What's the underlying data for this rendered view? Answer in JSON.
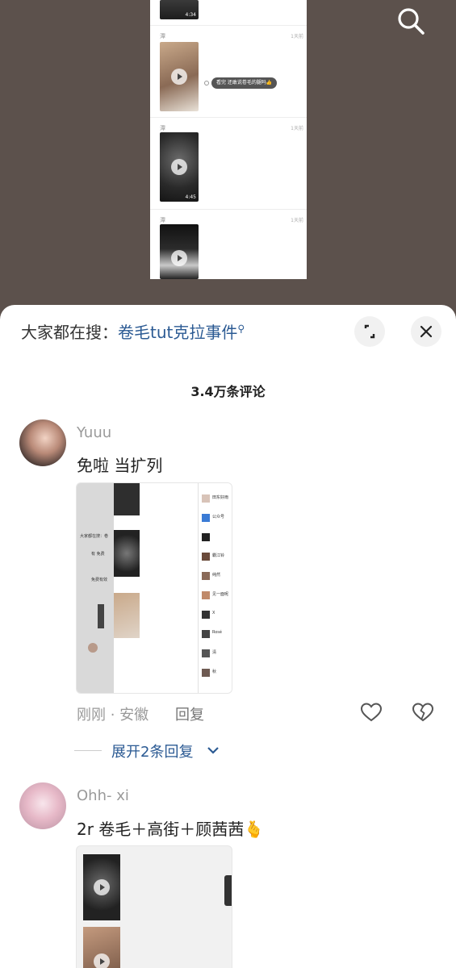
{
  "video": {
    "search_icon": "search-icon",
    "screenshot_rows": [
      {
        "name": "",
        "time": "",
        "duration": "4:34"
      },
      {
        "name": "潭",
        "time": "1天前",
        "duration": "",
        "bubble": "看完 还敢说卷毛的腿吗👍"
      },
      {
        "name": "潭",
        "time": "1天前",
        "duration": "4:45"
      },
      {
        "name": "潭",
        "time": "1天前",
        "duration": ""
      }
    ]
  },
  "sheet": {
    "hot_search_prefix": "大家都在搜：",
    "hot_search_keyword": "卷毛tut克拉事件",
    "comment_count": "3.4万条评论",
    "expand_icon": "expand-icon",
    "close_icon": "close-icon"
  },
  "comments": [
    {
      "username": "Yuuu",
      "text": "免啦 当扩列",
      "meta": "刚刚 · 安徽",
      "reply_label": "回复",
      "expand_replies": "展开2条回复",
      "image_contacts": [
        "田东好雨",
        "公众号",
        "",
        "霸江铃",
        "纯然",
        "见一面呢",
        "X",
        "Rosé",
        "清",
        "秋"
      ],
      "image_left_labels": [
        "大家都在搜：卷",
        "有 免费",
        "免费有效"
      ]
    },
    {
      "username": "Ohh- xi",
      "text": "2r 卷毛＋高街＋顾茜茜🫰"
    }
  ],
  "colors": {
    "accent_link": "#2b5a93",
    "sheet_bg": "#ffffff",
    "video_bg": "#5c514c"
  }
}
